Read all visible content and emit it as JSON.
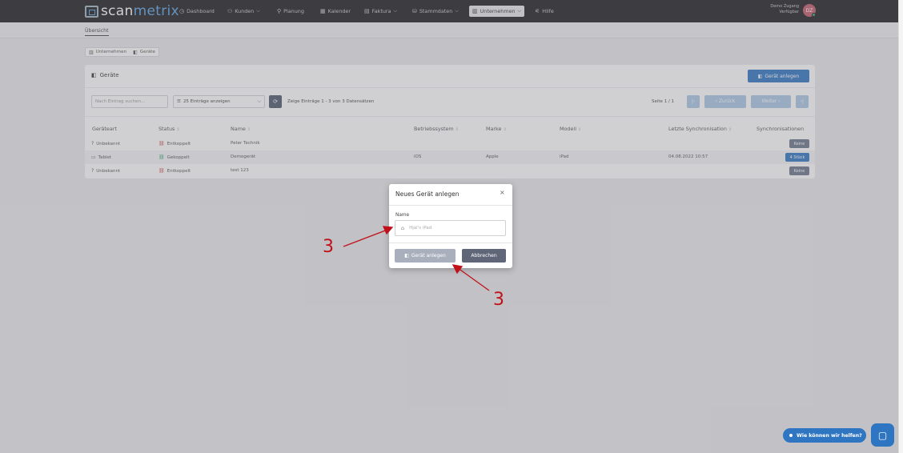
{
  "app": {
    "logo_scan": "scan",
    "logo_metrix": "metrix",
    "brand_color": "#2f76c2"
  },
  "nav": {
    "items": [
      {
        "label": "Dashboard",
        "icon": "dashboard-icon"
      },
      {
        "label": "Kunden",
        "icon": "users-icon",
        "dropdown": true
      },
      {
        "label": "Planung",
        "icon": "sitemap-icon"
      },
      {
        "label": "Kalender",
        "icon": "calendar-icon"
      },
      {
        "label": "Faktura",
        "icon": "invoice-icon",
        "dropdown": true
      },
      {
        "label": "Stammdaten",
        "icon": "database-icon",
        "dropdown": true
      },
      {
        "label": "Unternehmen",
        "icon": "building-icon",
        "dropdown": true,
        "active": true
      },
      {
        "label": "Hilfe",
        "icon": "help-icon"
      }
    ],
    "user_name": "Demo Zugang",
    "user_role": "Verfügbar",
    "avatar_initials": "DZ"
  },
  "subnav": {
    "tab": "Übersicht"
  },
  "breadcrumb": {
    "items": [
      "Unternehmen",
      "Geräte"
    ]
  },
  "card": {
    "title": "Geräte",
    "add_button": "Gerät anlegen",
    "search_placeholder": "Nach Eintrag suchen...",
    "entries_select": "25 Einträge anzeigen",
    "info": "Zeige Einträge 1 - 3 von 3 Datensätzen",
    "page_label": "Seite 1 / 1",
    "prev_label": "‹ Zurück",
    "next_label": "Weiter ›",
    "first_label": "|‹",
    "last_label": "›|"
  },
  "table": {
    "columns": [
      "Geräteart",
      "Status",
      "Name",
      "Betriebssystem",
      "Marke",
      "Modell",
      "Letzte Synchronisation",
      "Synchronisationen"
    ],
    "rows": [
      {
        "type": "Unbekannt",
        "status": "Entkoppelt",
        "name": "Peter Technik",
        "os": "",
        "brand": "",
        "model": "",
        "last_sync": "",
        "syncs": "Keine"
      },
      {
        "type": "Tablet",
        "status": "Gekoppelt",
        "name": "Demogerät",
        "os": "iOS",
        "brand": "Apple",
        "model": "iPad",
        "last_sync": "04.08.2022 10:57",
        "syncs": "4 Stück"
      },
      {
        "type": "Unbekannt",
        "status": "Entkoppelt",
        "name": "test 123",
        "os": "",
        "brand": "",
        "model": "",
        "last_sync": "",
        "syncs": "Keine"
      }
    ]
  },
  "modal": {
    "title": "Neues Gerät anlegen",
    "close": "×",
    "field_label": "Name",
    "field_placeholder": "Hjal's iPad",
    "submit": "Gerät anlegen",
    "cancel": "Abbrechen"
  },
  "annotations": {
    "left_number": "3",
    "bottom_number": "3"
  },
  "help": {
    "label": "Wie können wir helfen?"
  }
}
